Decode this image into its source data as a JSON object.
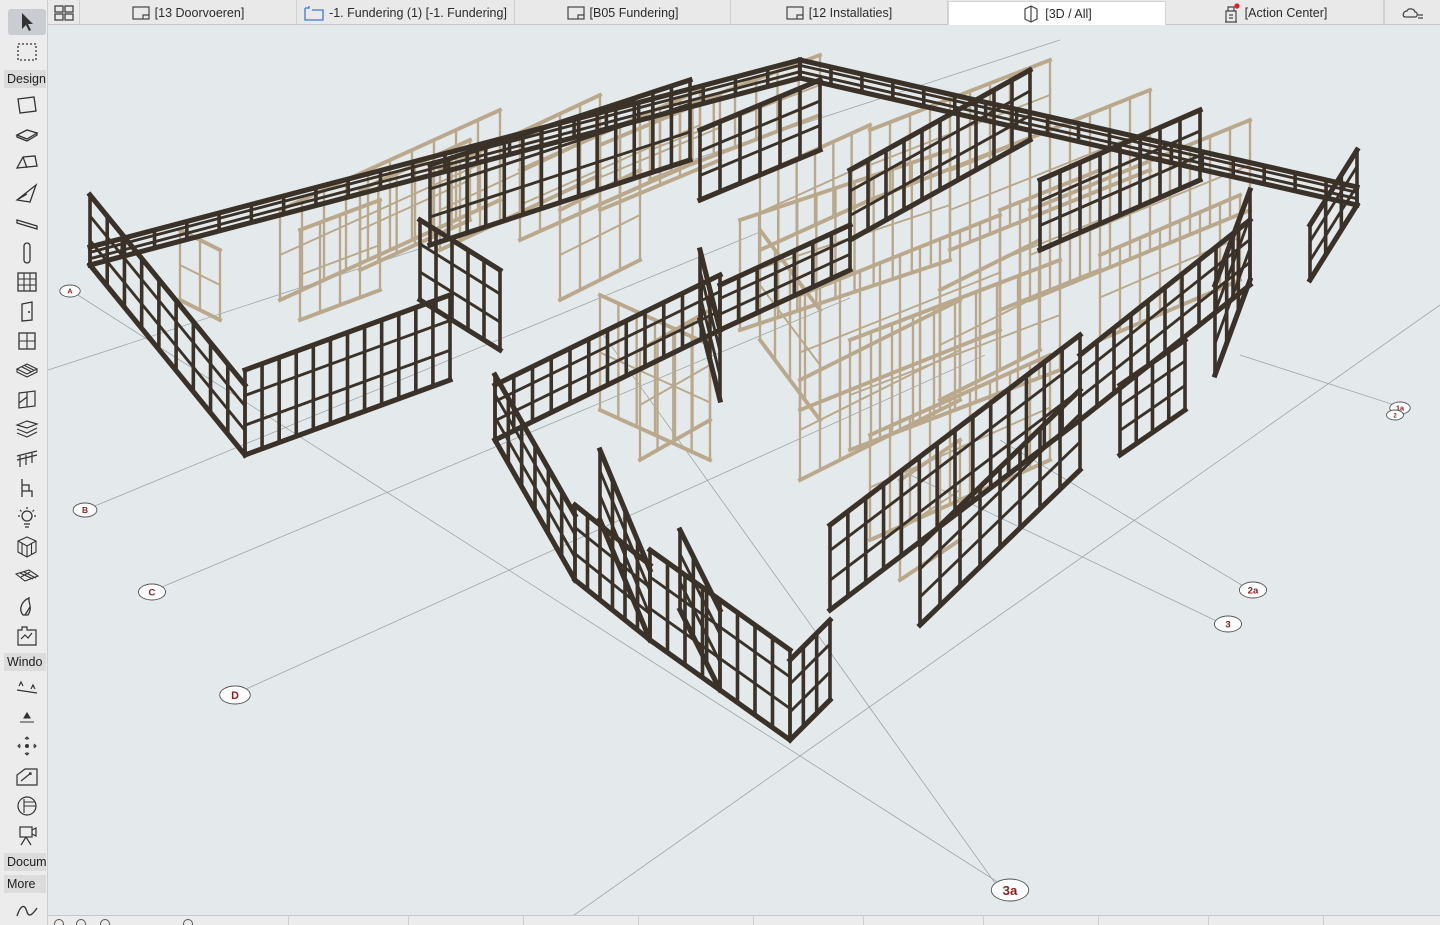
{
  "tabs": [
    {
      "id": "doorvoeren",
      "label": "[13 Doorvoeren]",
      "icon": "plan-view-icon",
      "active": false
    },
    {
      "id": "fundering",
      "label": "-1. Fundering (1) [-1. Fundering]",
      "icon": "floor-plan-icon",
      "active": false
    },
    {
      "id": "b05",
      "label": "[B05 Fundering]",
      "icon": "plan-view-icon",
      "active": false
    },
    {
      "id": "installaties",
      "label": "[12 Installaties]",
      "icon": "plan-view-icon",
      "active": false
    },
    {
      "id": "3d",
      "label": "[3D / All]",
      "icon": "3d-view-icon",
      "active": true
    },
    {
      "id": "action",
      "label": "[Action Center]",
      "icon": "action-center-icon",
      "active": false
    }
  ],
  "toolbox": {
    "design_label": "Design",
    "window_label": "Windo",
    "document_label": "Docum",
    "more_label": "More"
  },
  "grid_markers": [
    "A",
    "B",
    "C",
    "D",
    "1a",
    "2",
    "2a",
    "3",
    "3a"
  ],
  "colors": {
    "canvas": "#e4eaeb",
    "dark_wall": "#3a3128",
    "light_wall": "#b9a88c",
    "accent_marker": "#8a1c1c"
  }
}
